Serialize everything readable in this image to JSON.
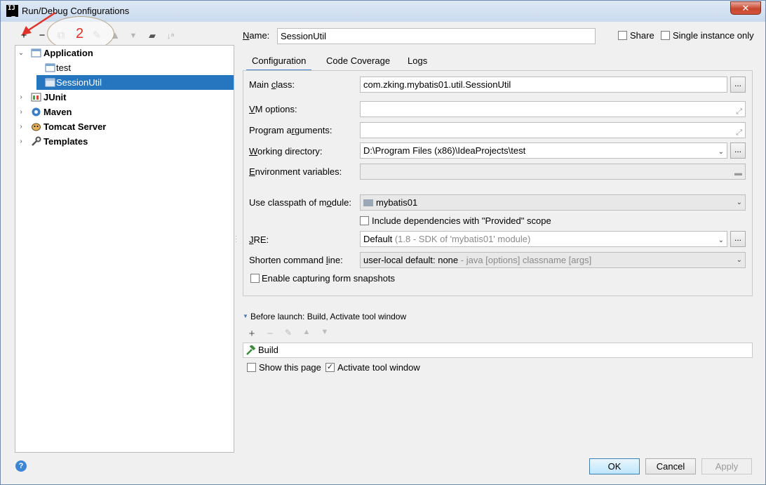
{
  "window": {
    "title": "Run/Debug Configurations",
    "close": "✕"
  },
  "left_toolbar": {
    "annotation_number": "2"
  },
  "tree": [
    {
      "label": "Application",
      "bold": true,
      "expanded": true,
      "icon": "application-icon"
    },
    {
      "label": "test",
      "bold": false,
      "icon": "config-icon"
    },
    {
      "label": "SessionUtil",
      "bold": false,
      "selected": true,
      "icon": "config-icon"
    },
    {
      "label": "JUnit",
      "bold": true,
      "icon": "junit-icon"
    },
    {
      "label": "Maven",
      "bold": true,
      "icon": "maven-icon"
    },
    {
      "label": "Tomcat Server",
      "bold": true,
      "icon": "tomcat-icon"
    },
    {
      "label": "Templates",
      "bold": true,
      "icon": "wrench-icon"
    }
  ],
  "name_row": {
    "label": "Name:",
    "value": "SessionUtil",
    "share": "Share",
    "single_instance": "Single instance only"
  },
  "tabs": [
    "Configuration",
    "Code Coverage",
    "Logs"
  ],
  "form": {
    "main_class": {
      "label": "Main class:",
      "value": "com.zking.mybatis01.util.SessionUtil"
    },
    "vm_options": {
      "label": "VM options:",
      "value": ""
    },
    "program_arguments": {
      "label": "Program arguments:",
      "value": ""
    },
    "working_directory": {
      "label": "Working directory:",
      "value": "D:\\Program Files (x86)\\IdeaProjects\\test"
    },
    "environment_variables": {
      "label": "Environment variables:",
      "value": ""
    },
    "classpath_module": {
      "label": "Use classpath of module:",
      "value": "mybatis01"
    },
    "include_provided": {
      "label": "Include dependencies with \"Provided\" scope",
      "checked": false
    },
    "jre": {
      "label": "JRE:",
      "value": "Default",
      "hint": " (1.8 - SDK of 'mybatis01' module)"
    },
    "shorten_command_line": {
      "label": "Shorten command line:",
      "value": "user-local default: none",
      "hint": " - java [options] classname [args]"
    },
    "capture_snapshots": {
      "label": "Enable capturing form snapshots",
      "checked": false
    },
    "browse": "..."
  },
  "before_launch": {
    "header": "Before launch: Build, Activate tool window",
    "items": [
      "Build"
    ],
    "show_this_page": {
      "label": "Show this page",
      "checked": false
    },
    "activate_tool_window": {
      "label": "Activate tool window",
      "checked": true
    }
  },
  "buttons": {
    "ok": "OK",
    "cancel": "Cancel",
    "apply": "Apply",
    "help": "?"
  },
  "colors": {
    "selection": "#2675bf",
    "accent": "#4083c9",
    "annotation": "#e0312a"
  }
}
